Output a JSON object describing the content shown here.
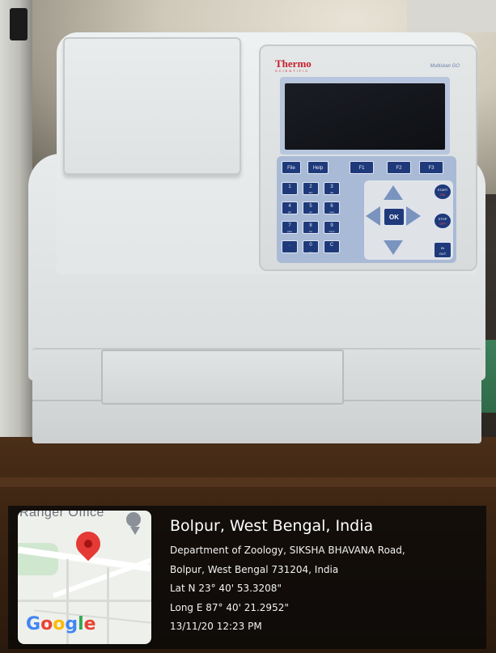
{
  "device": {
    "brand": "Thermo",
    "brand_sub": "SCIENTIFIC",
    "model": "Multiskan GO",
    "function_keys": [
      "File",
      "Help",
      "F1",
      "F2",
      "F3"
    ],
    "numeric_keys": [
      {
        "main": "1",
        "sub": ""
      },
      {
        "main": "2",
        "sub": "abc"
      },
      {
        "main": "3",
        "sub": "def"
      },
      {
        "main": "4",
        "sub": "ghi"
      },
      {
        "main": "5",
        "sub": "jkl"
      },
      {
        "main": "6",
        "sub": "mno"
      },
      {
        "main": "7",
        "sub": "pqrs"
      },
      {
        "main": "8",
        "sub": "tuv"
      },
      {
        "main": "9",
        "sub": "wxyz"
      },
      {
        "main": ".",
        "sub": ""
      },
      {
        "main": "0",
        "sub": "___"
      },
      {
        "main": "C",
        "sub": ""
      }
    ],
    "ok_label": "OK",
    "start_label": "START",
    "start_sub": "ON",
    "stop_label": "STOP",
    "stop_sub": "OFF",
    "in_label": "IN",
    "out_label": "OUT"
  },
  "geotag": {
    "map_place_label": "Ranger Office",
    "google_logo": "Google",
    "google_colors": [
      "#4285F4",
      "#EA4335",
      "#FBBC05",
      "#4285F4",
      "#34A853",
      "#EA4335"
    ],
    "city": "Bolpur, West Bengal, India",
    "address_line1": "Department of Zoology, SIKSHA BHAVANA Road,",
    "address_line2": "Bolpur, West Bengal 731204, India",
    "lat": "Lat N 23° 40' 53.3208\"",
    "long": "Long E 87° 40' 21.2952\"",
    "datetime": "13/11/20 12:23 PM"
  }
}
